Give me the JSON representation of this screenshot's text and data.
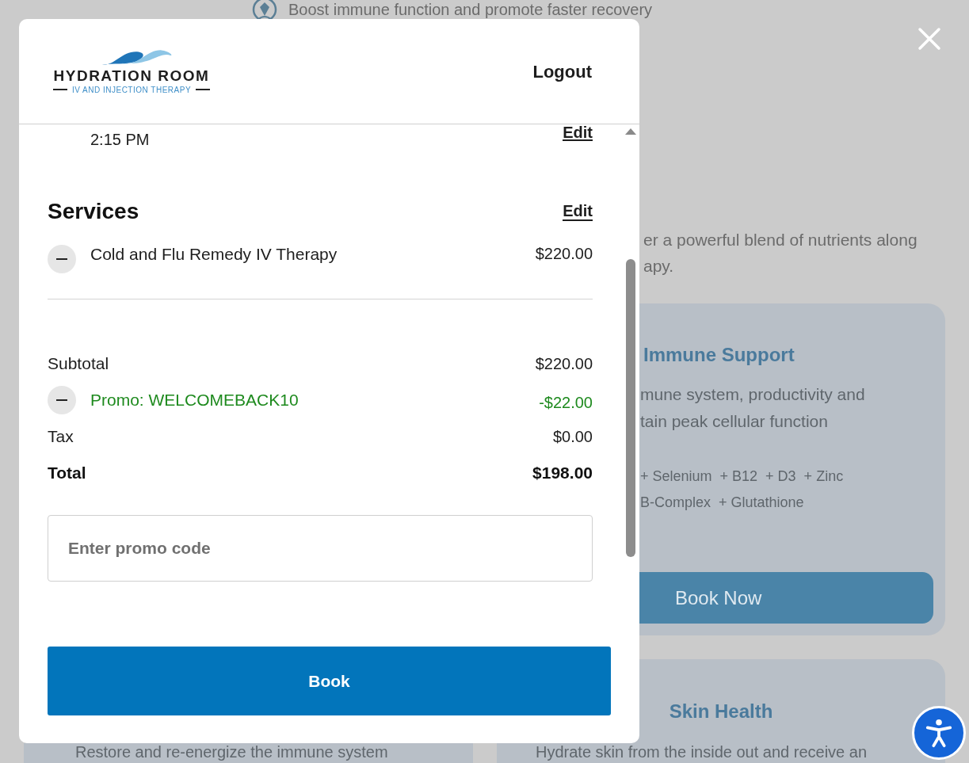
{
  "background_page": {
    "benefit": "Boost immune function and promote faster recovery",
    "intro_lines": [
      "er a powerful blend of nutrients along",
      "apy."
    ],
    "cards": [
      {
        "title": "Immune Support",
        "description_lines": [
          "mune system, productivity and",
          "tain peak cellular function"
        ],
        "ingredient_lines": [
          "+ Selenium  + B12  + D3  + Zinc",
          "B-Complex  + Glutathione"
        ],
        "button": "Book Now"
      },
      {
        "title": "Skin Health",
        "description_lines": [
          "Hydrate skin from the inside out and receive an"
        ]
      }
    ],
    "left_card": {
      "description": "Restore and re-energize the immune system"
    }
  },
  "modal": {
    "logo": {
      "name": "HYDRATION ROOM",
      "tagline": "IV AND INJECTION THERAPY"
    },
    "logout": "Logout",
    "appointment": {
      "time": "2:15 PM",
      "edit": "Edit"
    },
    "services": {
      "title": "Services",
      "edit": "Edit",
      "items": [
        {
          "name": "Cold and Flu Remedy IV Therapy",
          "price": "$220.00"
        }
      ]
    },
    "summary": [
      {
        "kind": "line",
        "label": "Subtotal",
        "amount": "$220.00"
      },
      {
        "kind": "promo",
        "label": "Promo: WELCOMEBACK10",
        "amount": "-$22.00"
      },
      {
        "kind": "line",
        "label": "Tax",
        "amount": "$0.00"
      },
      {
        "kind": "total",
        "label": "Total",
        "amount": "$198.00"
      }
    ],
    "promo_field": {
      "placeholder": "Enter promo code"
    },
    "book_button": "Book"
  }
}
